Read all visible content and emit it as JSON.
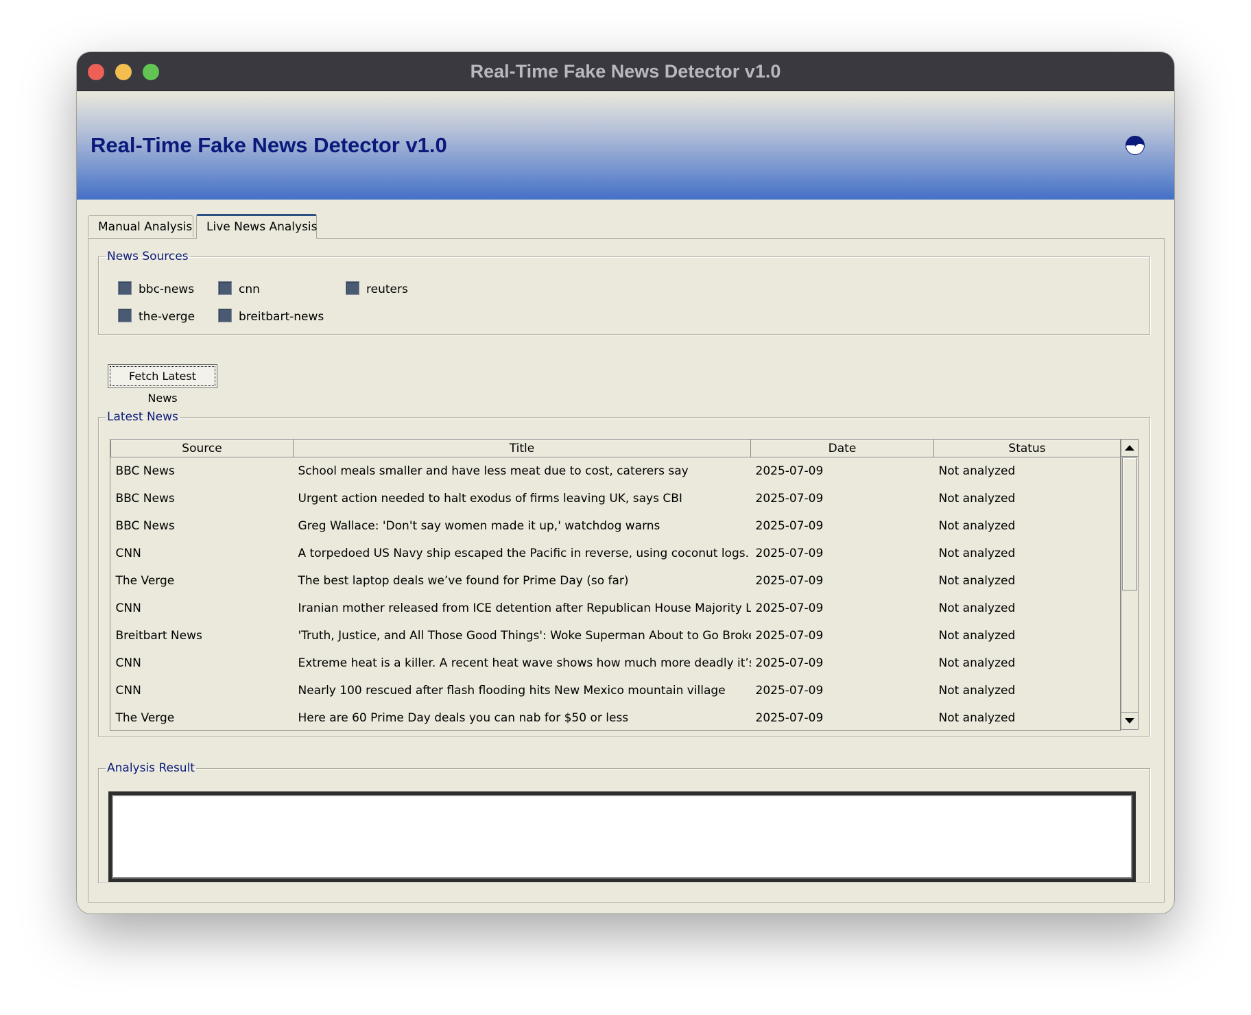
{
  "window": {
    "title": "Real-Time Fake News Detector v1.0"
  },
  "banner": {
    "title": "Real-Time Fake News Detector v1.0",
    "icon": "yin-yang-icon"
  },
  "tabs": [
    {
      "label": "Manual Analysis",
      "active": false
    },
    {
      "label": "Live News Analysis",
      "active": true
    }
  ],
  "news_sources": {
    "legend": "News Sources",
    "items": [
      {
        "label": "bbc-news",
        "checked": false
      },
      {
        "label": "cnn",
        "checked": false
      },
      {
        "label": "reuters",
        "checked": false
      },
      {
        "label": "the-verge",
        "checked": false
      },
      {
        "label": "breitbart-news",
        "checked": false
      }
    ]
  },
  "fetch_button": {
    "label": "Fetch Latest News"
  },
  "latest_news": {
    "legend": "Latest News",
    "columns": [
      "Source",
      "Title",
      "Date",
      "Status"
    ],
    "rows": [
      [
        "BBC News",
        "School meals smaller and have less meat due to cost, caterers say",
        "2025-07-09",
        "Not analyzed"
      ],
      [
        "BBC News",
        "Urgent action needed to halt exodus of firms leaving UK, says CBI",
        "2025-07-09",
        "Not analyzed"
      ],
      [
        "BBC News",
        "Greg Wallace: 'Don't say women made it up,' watchdog warns",
        "2025-07-09",
        "Not analyzed"
      ],
      [
        "CNN",
        "A torpedoed US Navy ship escaped the Pacific in reverse, using coconut logs. Its",
        "2025-07-09",
        "Not analyzed"
      ],
      [
        "The Verge",
        "The best laptop deals we’ve found for Prime Day (so far)",
        "2025-07-09",
        "Not analyzed"
      ],
      [
        "CNN",
        "Iranian mother released from ICE detention after Republican House Majority Leac",
        "2025-07-09",
        "Not analyzed"
      ],
      [
        "Breitbart News",
        "'Truth, Justice, and All Those Good Things': Woke Superman About to Go Broke",
        "2025-07-09",
        "Not analyzed"
      ],
      [
        "CNN",
        "Extreme heat is a killer. A recent heat wave shows how much more deadly it’s be",
        "2025-07-09",
        "Not analyzed"
      ],
      [
        "CNN",
        "Nearly 100 rescued after flash flooding hits New Mexico mountain village",
        "2025-07-09",
        "Not analyzed"
      ],
      [
        "The Verge",
        "Here are 60 Prime Day deals you can nab for $50 or less",
        "2025-07-09",
        "Not analyzed"
      ]
    ]
  },
  "analysis_result": {
    "legend": "Analysis Result",
    "text": ""
  },
  "colors": {
    "legend_text": "#0b1a7a",
    "banner_gradient_bottom": "#4470c6",
    "window_background": "#ebe9db",
    "titlebar": "#3a3940"
  }
}
